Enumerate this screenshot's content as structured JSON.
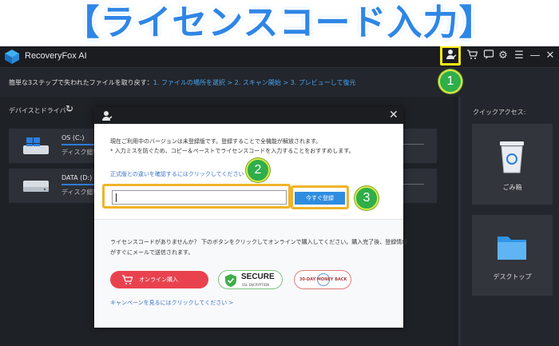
{
  "headline": "【ライセンスコード入力】",
  "app": {
    "title": "RecoveryFox AI"
  },
  "stepbar": {
    "prefix": "簡単な3ステップで失われたファイルを取り戻す：",
    "steps": "1. ファイルの場所を選択 > 2. スキャン開始 > 3. プレビューして復元"
  },
  "devices": {
    "title": "デバイスとドライバー",
    "drives": [
      {
        "name": "OS (C:)",
        "sub": "ディスク総容"
      },
      {
        "name": "DATA (D:)",
        "sub": "ディスク総容"
      }
    ]
  },
  "quick": {
    "title": "クイックアクセス:",
    "items": [
      {
        "label": "ごみ箱"
      },
      {
        "label": "デスクトップ"
      }
    ]
  },
  "modal": {
    "info_line1": "現在ご利用中のバージョンは未登録版です。登録することで全機能が解放されます。",
    "info_line2": "* 入力ミスを防ぐため、コピー＆ペーストでライセンスコードを入力することをおすすめします。",
    "compare_link": "正式版との違いを確認するにはクリックしてください >",
    "register_button": "今すぐ登録",
    "info_line3": "ライセンスコードがありませんか？ 下のボタンをクリックしてオンラインで購入してください。購入完了後、登録情報",
    "info_line4": "がすぐにメールで送信されます。",
    "buy_button": "オンライン購入",
    "secure": {
      "title": "SECURE",
      "sub": "SSL ENCRYPTION"
    },
    "money_back": "30-DAY MONEY BACK",
    "campaign_link": "キャンペーンを見るにはクリックしてください >"
  },
  "markers": [
    "1",
    "2",
    "3"
  ],
  "colors": {
    "accent": "#2f8de0",
    "buy": "#e9424f",
    "highlight": "#f5ea14",
    "frame": "#f0b429",
    "marker": "#2fae4a"
  }
}
